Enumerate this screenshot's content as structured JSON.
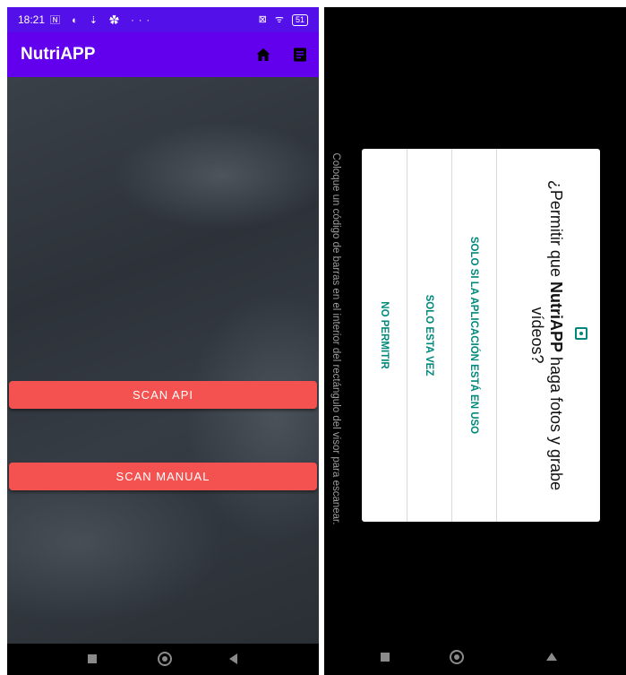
{
  "status_bar": {
    "time": "18:21",
    "left_icons": "🄽 ◐ ⇣ ✿ ···",
    "right_icons": "⊠ ᯤ",
    "battery": "51"
  },
  "app_bar": {
    "title": "NutriAPP",
    "icons": [
      "home-icon",
      "list-icon"
    ]
  },
  "main": {
    "scan_api_label": "SCAN API",
    "scan_manual_label": "SCAN MANUAL"
  },
  "nav_bar": {
    "icons": [
      "recents-icon",
      "home-circle-icon",
      "back-icon"
    ]
  },
  "scanner": {
    "hint": "Coloque un código de barras en el interior del rectángulo del visor para escanear."
  },
  "permission_dialog": {
    "title_prefix": "¿Permitir que ",
    "app_name": "NutriAPP",
    "title_suffix": " haga fotos y grabe vídeos?",
    "icon": "camera-icon",
    "buttons": {
      "while_in_use": "SOLO SI LA APLICACIÓN ESTÁ EN USO",
      "only_this_time": "SOLO ESTA VEZ",
      "deny": "NO PERMITIR"
    }
  },
  "colors": {
    "status_bar": "#5410e8",
    "app_bar": "#6200ee",
    "scan_button": "#f35250",
    "dialog_accent": "#00897b"
  }
}
